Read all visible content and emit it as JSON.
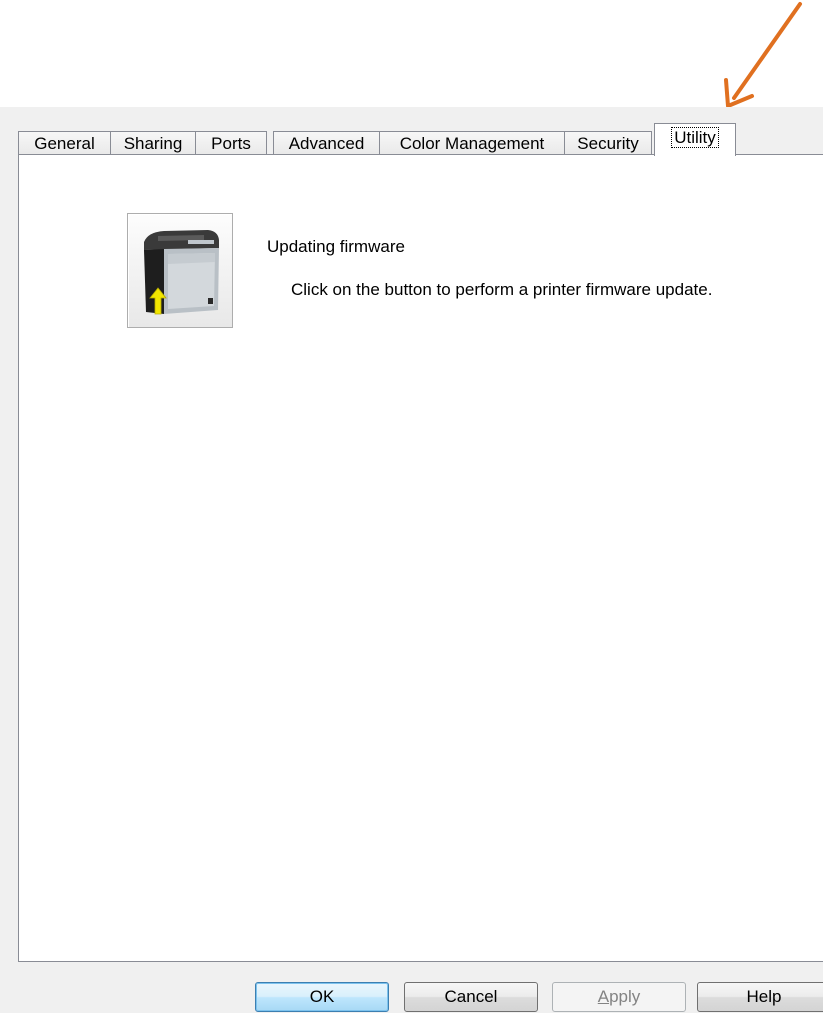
{
  "tabs": [
    {
      "label": "General"
    },
    {
      "label": "Sharing"
    },
    {
      "label": "Ports"
    },
    {
      "label": "Advanced"
    },
    {
      "label": "Color Management"
    },
    {
      "label": "Security"
    },
    {
      "label": "Utility"
    }
  ],
  "active_tab": "Utility",
  "utility": {
    "section_title": "Updating firmware",
    "section_description": "Click on the button to perform a printer firmware update.",
    "firmware_button_icon": "printer-firmware-update-icon"
  },
  "buttons": {
    "ok": "OK",
    "cancel": "Cancel",
    "apply_mnemonic": "A",
    "apply_rest": "pply",
    "help": "Help"
  },
  "colors": {
    "annotation_arrow": "#e07020",
    "upload_arrow": "#f2e600",
    "ok_button_border": "#3c7fb1"
  }
}
